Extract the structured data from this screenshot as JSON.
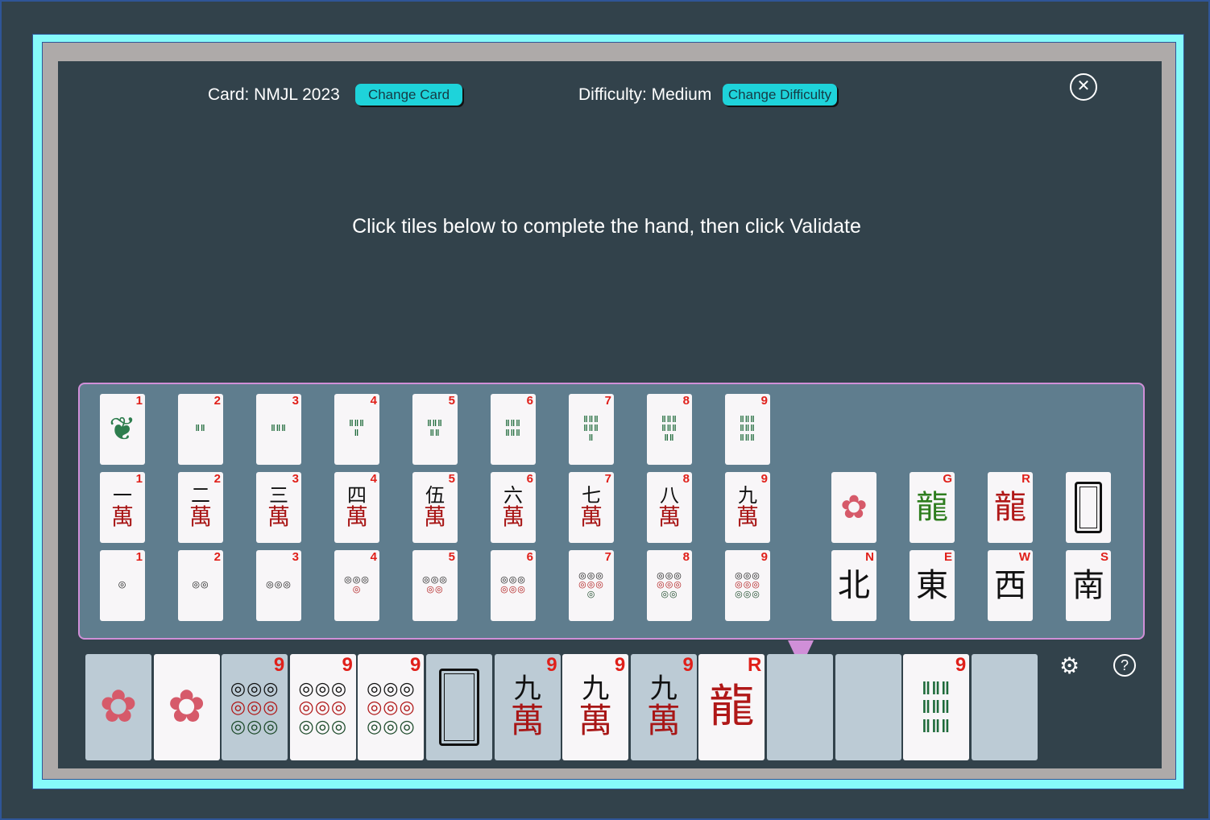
{
  "header": {
    "card_label": "Card: NMJL 2023",
    "change_card": "Change Card",
    "difficulty_label": "Difficulty: Medium",
    "change_difficulty": "Change Difficulty",
    "close_icon": "close-icon"
  },
  "instruction": "Click tiles below to complete the hand, then click Validate",
  "colors": {
    "accent": "#1ed3da",
    "frame": "#86fafa",
    "palette_bg": "#5f7d8e",
    "palette_border": "#d08fd8",
    "corner_red": "#e0201a"
  },
  "palette": {
    "bams": [
      {
        "s": "bam",
        "n": 1,
        "c": "1"
      },
      {
        "s": "bam",
        "n": 2,
        "c": "2"
      },
      {
        "s": "bam",
        "n": 3,
        "c": "3"
      },
      {
        "s": "bam",
        "n": 4,
        "c": "4"
      },
      {
        "s": "bam",
        "n": 5,
        "c": "5"
      },
      {
        "s": "bam",
        "n": 6,
        "c": "6"
      },
      {
        "s": "bam",
        "n": 7,
        "c": "7"
      },
      {
        "s": "bam",
        "n": 8,
        "c": "8"
      },
      {
        "s": "bam",
        "n": 9,
        "c": "9"
      }
    ],
    "craks": [
      {
        "s": "crak",
        "n": 1,
        "c": "1",
        "t": "一"
      },
      {
        "s": "crak",
        "n": 2,
        "c": "2",
        "t": "二"
      },
      {
        "s": "crak",
        "n": 3,
        "c": "3",
        "t": "三"
      },
      {
        "s": "crak",
        "n": 4,
        "c": "4",
        "t": "四"
      },
      {
        "s": "crak",
        "n": 5,
        "c": "5",
        "t": "伍"
      },
      {
        "s": "crak",
        "n": 6,
        "c": "6",
        "t": "六"
      },
      {
        "s": "crak",
        "n": 7,
        "c": "7",
        "t": "七"
      },
      {
        "s": "crak",
        "n": 8,
        "c": "8",
        "t": "八"
      },
      {
        "s": "crak",
        "n": 9,
        "c": "9",
        "t": "九"
      }
    ],
    "dots": [
      {
        "s": "dot",
        "n": 1,
        "c": "1"
      },
      {
        "s": "dot",
        "n": 2,
        "c": "2"
      },
      {
        "s": "dot",
        "n": 3,
        "c": "3"
      },
      {
        "s": "dot",
        "n": 4,
        "c": "4"
      },
      {
        "s": "dot",
        "n": 5,
        "c": "5"
      },
      {
        "s": "dot",
        "n": 6,
        "c": "6"
      },
      {
        "s": "dot",
        "n": 7,
        "c": "7"
      },
      {
        "s": "dot",
        "n": 8,
        "c": "8"
      },
      {
        "s": "dot",
        "n": 9,
        "c": "9"
      }
    ],
    "honors_top": [
      {
        "s": "flower",
        "c": ""
      },
      {
        "s": "dragon",
        "c": "G",
        "color": "#2e7d1e"
      },
      {
        "s": "dragon",
        "c": "R",
        "color": "#b01818"
      },
      {
        "s": "soap",
        "c": ""
      }
    ],
    "winds": [
      {
        "s": "wind",
        "c": "N",
        "t": "北"
      },
      {
        "s": "wind",
        "c": "E",
        "t": "東"
      },
      {
        "s": "wind",
        "c": "W",
        "t": "西"
      },
      {
        "s": "wind",
        "c": "S",
        "t": "南"
      }
    ]
  },
  "hand": [
    {
      "s": "flower",
      "c": "",
      "hl": true
    },
    {
      "s": "flower",
      "c": ""
    },
    {
      "s": "dot",
      "n": 9,
      "c": "9",
      "hl": true
    },
    {
      "s": "dot",
      "n": 9,
      "c": "9"
    },
    {
      "s": "dot",
      "n": 9,
      "c": "9"
    },
    {
      "s": "soap",
      "c": "",
      "hl": true
    },
    {
      "s": "crak",
      "n": 9,
      "c": "9",
      "t": "九",
      "hl": true
    },
    {
      "s": "crak",
      "n": 9,
      "c": "9",
      "t": "九"
    },
    {
      "s": "crak",
      "n": 9,
      "c": "9",
      "t": "九",
      "hl": true
    },
    {
      "s": "dragon",
      "c": "R",
      "color": "#b01818"
    },
    {
      "s": "empty"
    },
    {
      "s": "empty"
    },
    {
      "s": "bam",
      "n": 9,
      "c": "9"
    },
    {
      "s": "empty"
    }
  ],
  "icons": {
    "settings": "gear-icon",
    "help": "help-icon"
  }
}
